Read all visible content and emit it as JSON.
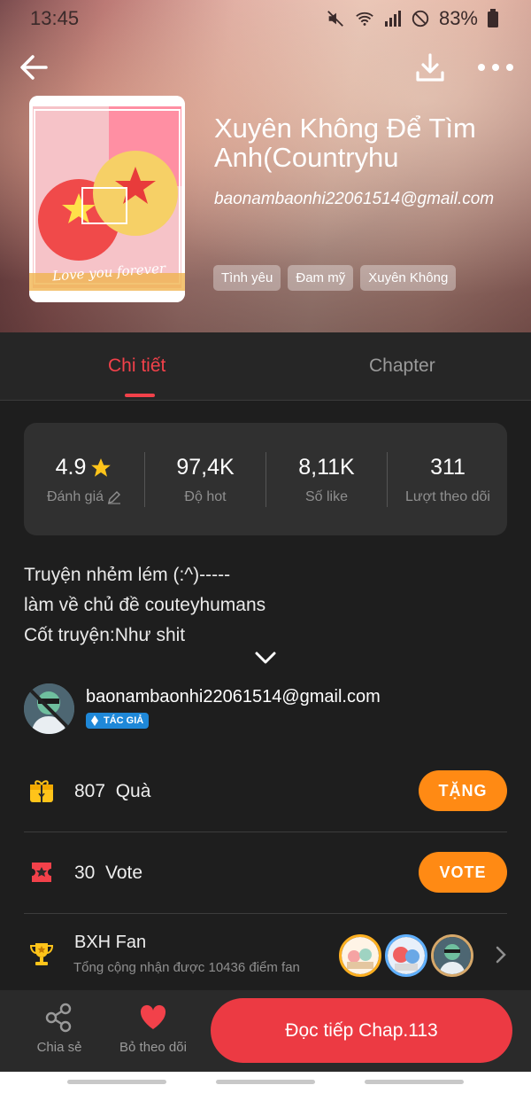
{
  "status_bar": {
    "time": "13:45",
    "battery": "83%"
  },
  "toolbar": {
    "back_icon": "arrow-left-icon",
    "download_icon": "download-icon",
    "more_icon": "more-horizontal-icon"
  },
  "story": {
    "title": "Xuyên Không Để Tìm Anh(Countryhu",
    "author_email": "baonambaonhi22061514@gmail.com",
    "tags": [
      "Tình yêu",
      "Đam mỹ",
      "Xuyên Không"
    ],
    "cover_text": "Love you forever"
  },
  "tabs": [
    {
      "label": "Chi tiết",
      "active": true
    },
    {
      "label": "Chapter",
      "active": false
    }
  ],
  "stats": {
    "rating": {
      "value": "4.9",
      "label": "Đánh giá"
    },
    "hot": {
      "value": "97,4K",
      "label": "Độ hot"
    },
    "likes": {
      "value": "8,11K",
      "label": "Số like"
    },
    "followers": {
      "value": "311",
      "label": "Lượt theo dõi"
    }
  },
  "description": {
    "line1": "Truyện nhẻm lém (:^)-----",
    "line2": "làm về chủ đề couteyhumans",
    "line3": "Cốt truyện:Như shit"
  },
  "author": {
    "name": "baonambaonhi22061514@gmail.com",
    "badge": "TÁC GIẢ"
  },
  "gifts": {
    "count": "807",
    "label": "Quà",
    "button": "TẶNG"
  },
  "votes": {
    "count": "30",
    "label": "Vote",
    "button": "VOTE"
  },
  "fan_ranking": {
    "title": "BXH Fan",
    "subtitle": "Tổng cộng nhận được 10436 điểm fan"
  },
  "bottom_bar": {
    "share": "Chia sẻ",
    "unfollow": "Bỏ theo dõi",
    "read_button": "Đọc tiếp Chap.113"
  },
  "colors": {
    "accent": "#f2414a",
    "orange": "#ff8a14",
    "badge_blue": "#1f88d8",
    "background": "#1e1e1e"
  }
}
